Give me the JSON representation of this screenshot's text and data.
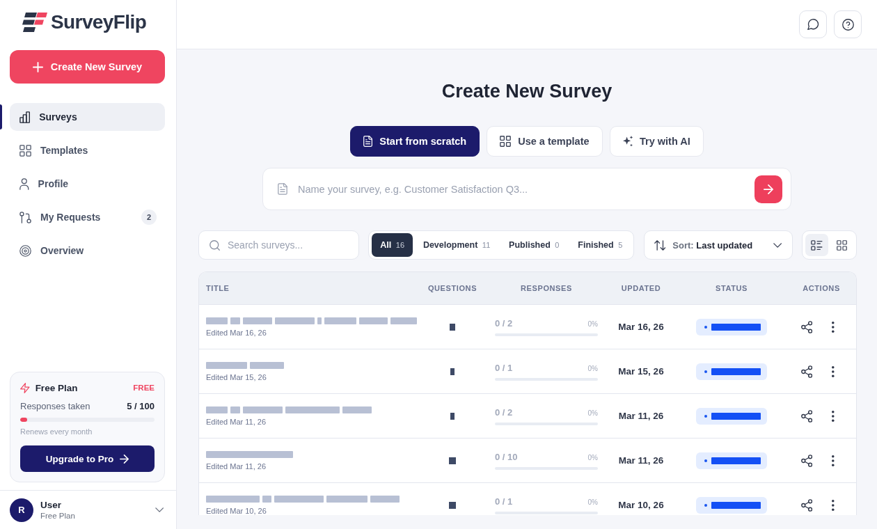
{
  "sidebar": {
    "logo": "SurveyFlip",
    "create_button": "Create New Survey",
    "nav": [
      {
        "label": "Surveys",
        "selected": true
      },
      {
        "label": "Templates",
        "selected": false
      },
      {
        "label": "Profile",
        "selected": false
      },
      {
        "label": "My Requests",
        "selected": false,
        "badge": "2"
      },
      {
        "label": "Overview",
        "selected": false
      }
    ],
    "plan_card": {
      "title": "Free Plan",
      "tier": "FREE",
      "usage_label": "Responses taken",
      "usage": "5 / 100",
      "level": 0.05,
      "note": "Renews every month",
      "button": "Upgrade to Pro"
    },
    "user": {
      "initial": "R",
      "name": "User",
      "plan": "Free Plan"
    }
  },
  "create_panel": {
    "title": "Create New Survey",
    "modes": [
      {
        "label": "Start from scratch",
        "selected": true
      },
      {
        "label": "Use a template",
        "selected": false
      },
      {
        "label": "Try with AI",
        "selected": false
      }
    ],
    "name_field": {
      "placeholder": "Name your survey, e.g. Customer Satisfaction Q3..."
    }
  },
  "toolbar": {
    "search": {
      "placeholder": "Search surveys..."
    },
    "filters": [
      {
        "label": "All",
        "count": "16",
        "selected": true
      },
      {
        "label": "Development",
        "count": "11",
        "selected": false
      },
      {
        "label": "Published",
        "count": "0",
        "selected": false
      },
      {
        "label": "Finished",
        "count": "5",
        "selected": false
      }
    ],
    "sort": {
      "label": "Sort:",
      "value": "Last updated"
    },
    "views": [
      {
        "kind": "list",
        "selected": true
      },
      {
        "kind": "grid",
        "selected": false
      }
    ]
  },
  "table": {
    "columns": [
      "TITLE",
      "QUESTIONS",
      "RESPONSES",
      "UPDATED",
      "STATUS",
      "ACTIONS"
    ],
    "rows": [
      {
        "title_redacted": true,
        "edited": "Edited Mar 16, 26",
        "questions_redacted": true,
        "responses": "0 / 2",
        "percent": "0%",
        "level": 0,
        "updated": "Mar 16, 26",
        "status_redacted": true
      },
      {
        "title_redacted": true,
        "edited": "Edited Mar 15, 26",
        "questions_redacted": true,
        "responses": "0 / 1",
        "percent": "0%",
        "level": 0,
        "updated": "Mar 15, 26",
        "status_redacted": true
      },
      {
        "title_redacted": true,
        "edited": "Edited Mar 11, 26",
        "questions_redacted": true,
        "responses": "0 / 2",
        "percent": "0%",
        "level": 0,
        "updated": "Mar 11, 26",
        "status_redacted": true
      },
      {
        "title_redacted": true,
        "edited": "Edited Mar 11, 26",
        "questions_redacted": true,
        "responses": "0 / 10",
        "percent": "0%",
        "level": 0,
        "updated": "Mar 11, 26",
        "status_redacted": true
      },
      {
        "title_redacted": true,
        "edited": "Edited Mar 10, 26",
        "questions_redacted": true,
        "responses": "0 / 1",
        "percent": "0%",
        "level": 0,
        "updated": "Mar 10, 26",
        "status_redacted": true
      }
    ]
  }
}
